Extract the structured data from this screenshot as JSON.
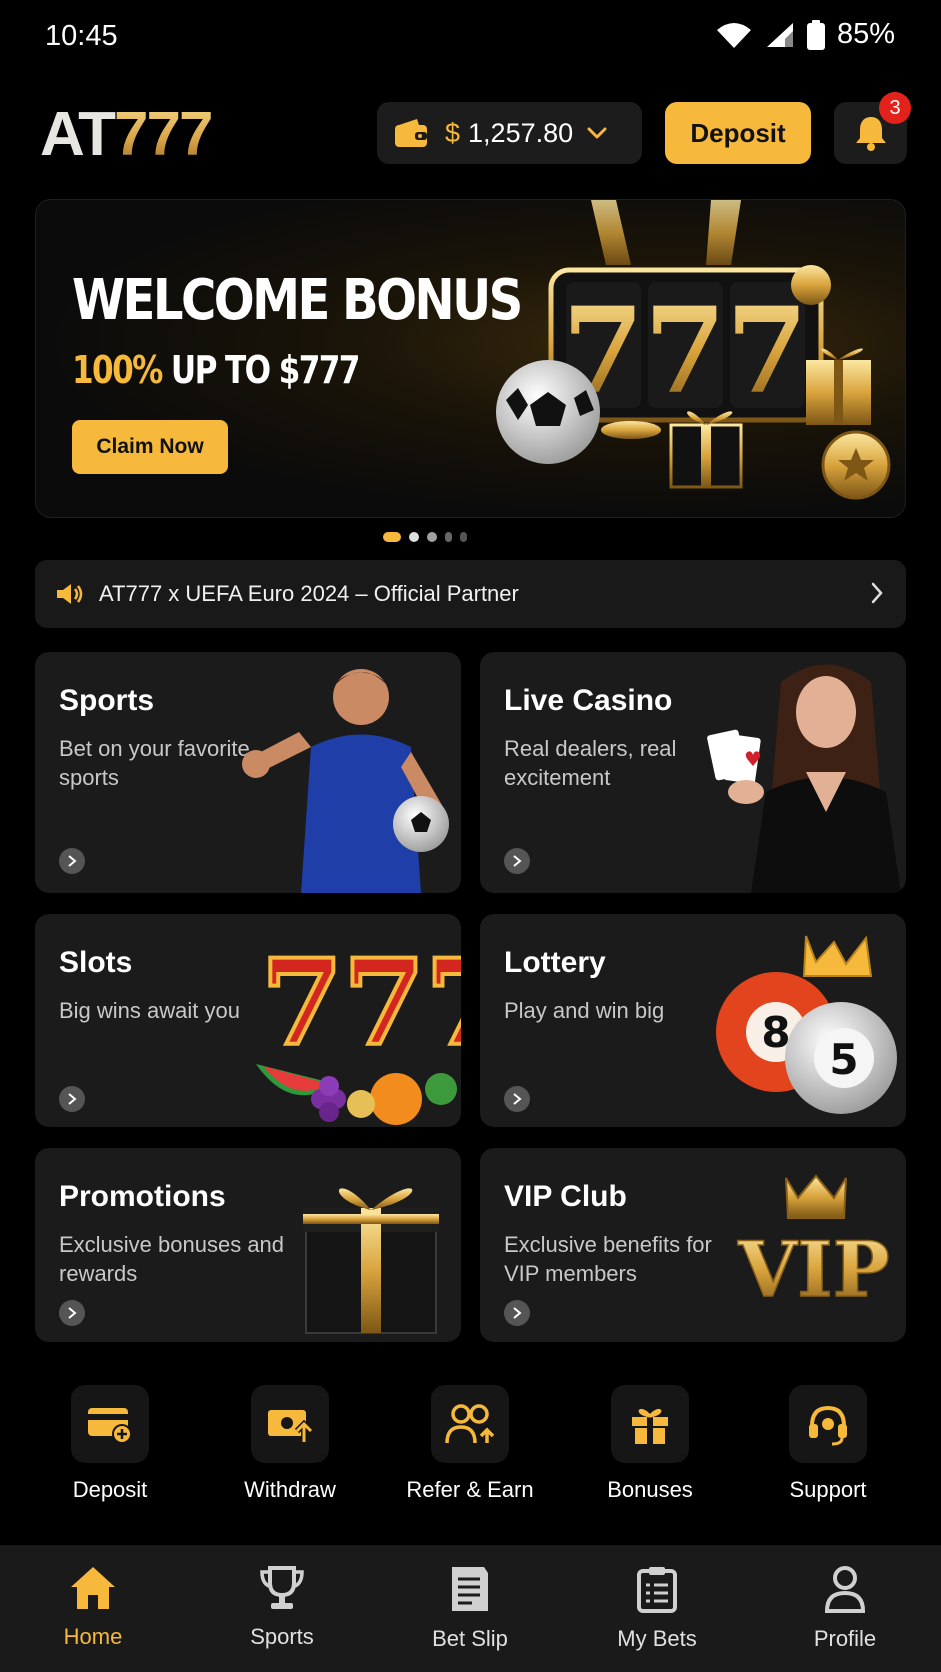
{
  "status_bar": {
    "time": "10:45",
    "battery": "85%"
  },
  "header": {
    "logo_prefix": "AT",
    "logo_number": "777",
    "wallet_currency": "$",
    "wallet_balance": "1,257.80",
    "deposit_label": "Deposit",
    "notification_count": "3"
  },
  "banner": {
    "title": "WELCOME BONUS",
    "subtitle_highlight": "100%",
    "subtitle_middle": " UP TO ",
    "subtitle_amount": "$777",
    "cta": "Claim Now",
    "slide_count": 5,
    "active_slide": 1
  },
  "ticker": {
    "text": "AT777 x UEFA Euro 2024 – Official Partner"
  },
  "categories": [
    {
      "title": "Sports",
      "desc": "Bet on your favorite sports"
    },
    {
      "title": "Live Casino",
      "desc": "Real dealers, real excitement"
    },
    {
      "title": "Slots",
      "desc": "Big wins await you"
    },
    {
      "title": "Lottery",
      "desc": "Play and win big"
    },
    {
      "title": "Promotions",
      "desc": "Exclusive bonuses and rewards"
    },
    {
      "title": "VIP Club",
      "desc": "Exclusive benefits for VIP members"
    }
  ],
  "vip_art_text": "VIP",
  "lottery_balls": [
    "8",
    "5"
  ],
  "quick_actions": [
    {
      "label": "Deposit",
      "icon": "card-plus-icon"
    },
    {
      "label": "Withdraw",
      "icon": "cash-out-icon"
    },
    {
      "label": "Refer & Earn",
      "icon": "users-plus-icon"
    },
    {
      "label": "Bonuses",
      "icon": "gift-icon"
    },
    {
      "label": "Support",
      "icon": "headset-icon"
    }
  ],
  "bottom_nav": [
    {
      "label": "Home",
      "icon": "home-icon",
      "active": true
    },
    {
      "label": "Sports",
      "icon": "trophy-icon"
    },
    {
      "label": "Bet Slip",
      "icon": "bet-slip-icon"
    },
    {
      "label": "My Bets",
      "icon": "clipboard-icon"
    },
    {
      "label": "Profile",
      "icon": "user-icon"
    }
  ],
  "colors": {
    "accent": "#f6b93b",
    "background": "#000000",
    "card": "#1b1b1b",
    "badge": "#e3231b"
  }
}
